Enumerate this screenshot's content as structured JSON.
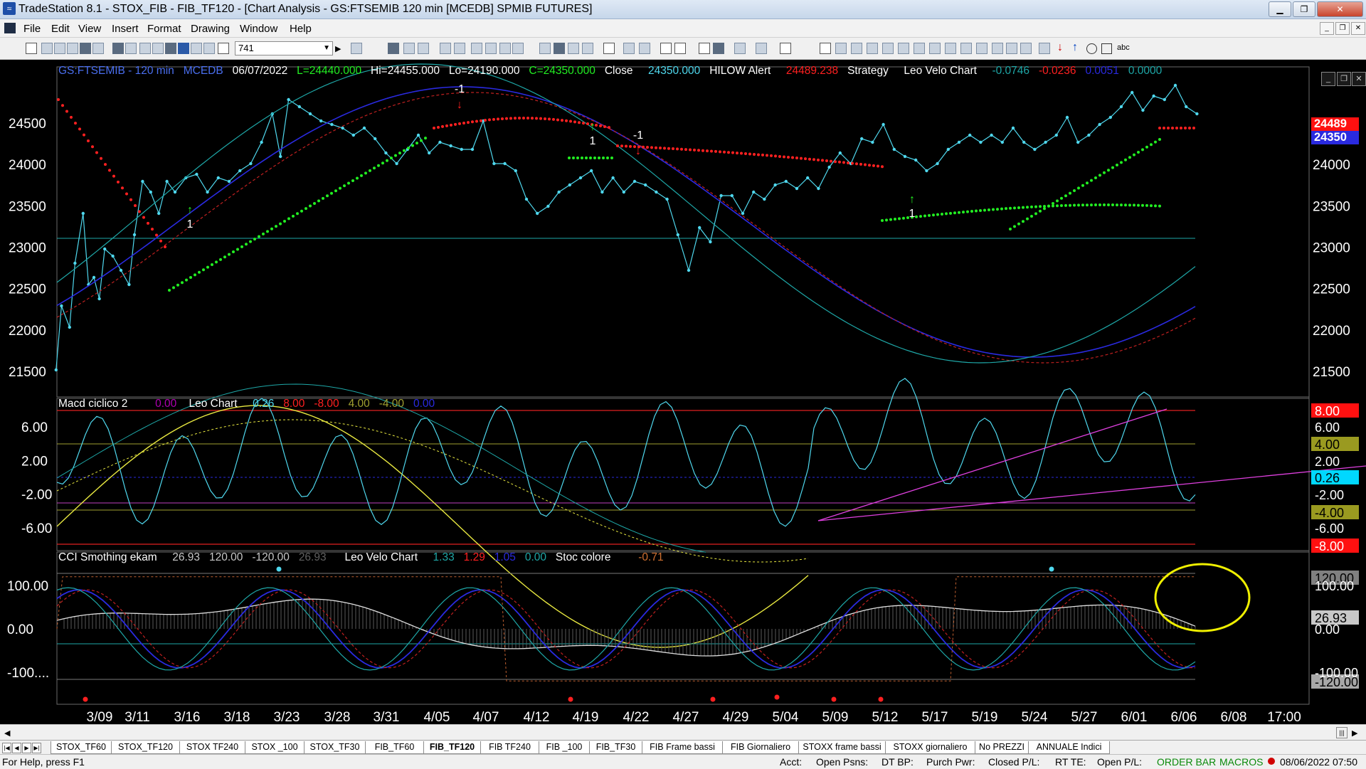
{
  "window": {
    "title": "TradeStation 8.1 - STOX_FIB - FIB_TF120 - [Chart Analysis - GS:FTSEMIB  120 min  [MCEDB] SPMIB FUTURES]",
    "icon": "tradestation-icon"
  },
  "menu": [
    "File",
    "Edit",
    "View",
    "Insert",
    "Format",
    "Drawing",
    "Window",
    "Help"
  ],
  "toolbar": {
    "combo_value": "741"
  },
  "price_panel": {
    "symbol": "GS:FTSEMIB - 120 min",
    "exchange": "MCEDB",
    "date": "06/07/2022",
    "L": "L=24440.000",
    "Hi": "Hi=24455.000",
    "Lo": "Lo=24190.000",
    "C": "C=24350.000",
    "close_label": "Close",
    "close_value": "24350.000",
    "hilow_label": "HILOW Alert",
    "hilow_value": "24489.238",
    "strategy_label": "Strategy",
    "velo_label": "Leo Velo Chart",
    "velo_v1": "-0.0746",
    "velo_v2": "-0.0236",
    "velo_v3": "0.0051",
    "velo_v4": "0.0000",
    "y_ticks": [
      "24500",
      "24000",
      "23500",
      "23000",
      "22500",
      "22000",
      "21500"
    ],
    "right_box_1": "24489",
    "right_box_2": "24350",
    "signals": [
      "1",
      "-1",
      "1",
      "-1",
      "1"
    ]
  },
  "macd_panel": {
    "label": "Macd ciclico 2",
    "v0": "0.00",
    "leo": "Leo Chart",
    "v1": "0.26",
    "v2": "8.00",
    "v3": "-8.00",
    "v4": "4.00",
    "v5": "-4.00",
    "v6": "0.00",
    "y_ticks": [
      "6.00",
      "2.00",
      "-2.00",
      "-6.00"
    ],
    "right_ticks": [
      "8.00",
      "6.00",
      "4.00",
      "2.00",
      "0.26",
      "-2.00",
      "-4.00",
      "-6.00",
      "-8.00"
    ]
  },
  "cci_panel": {
    "label": "CCI Smothing ekam",
    "v1": "26.93",
    "v2": "120.00",
    "v3": "-120.00",
    "v4": "26.93",
    "leo": "Leo Velo Chart",
    "v5": "1.33",
    "v6": "1.29",
    "v7": "1.05",
    "v8": "0.00",
    "stoc": "Stoc colore",
    "v9": "-0.71",
    "y_ticks": [
      "100.00",
      "0.00",
      "-100...."
    ],
    "right_ticks": [
      "120.00",
      "100.00",
      "26.93",
      "0.00",
      "-100.00",
      "-120.00"
    ]
  },
  "x_axis": [
    "3/09",
    "3/11",
    "3/16",
    "3/18",
    "3/23",
    "3/28",
    "3/31",
    "4/05",
    "4/07",
    "4/12",
    "4/19",
    "4/22",
    "4/27",
    "4/29",
    "5/04",
    "5/09",
    "5/12",
    "5/17",
    "5/19",
    "5/24",
    "5/27",
    "6/01",
    "6/06",
    "6/08",
    "17:00"
  ],
  "tabs": [
    "STOX_TF60",
    "STOX_TF120",
    "STOX TF240",
    "STOX _100",
    "STOX_TF30",
    "FIB_TF60",
    "FIB_TF120",
    "FIB TF240",
    "FIB _100",
    "FIB_TF30",
    "FIB Frame bassi",
    "FIB Giornaliero",
    "STOXX frame bassi",
    "STOXX giornaliero",
    "No PREZZI",
    "ANNUALE Indici"
  ],
  "active_tab": "FIB_TF120",
  "status": {
    "help": "For Help, press F1",
    "acct": "Acct:",
    "open_psns": "Open Psns:",
    "dt_bp": "DT BP:",
    "purch_pwr": "Purch Pwr:",
    "closed_pl": "Closed P/L:",
    "rt_te": "RT TE:",
    "open_pl": "Open P/L:",
    "order_bar": "ORDER BAR",
    "macros": "MACROS",
    "datetime": "08/06/2022 07:50"
  },
  "colors": {
    "cyan": "#4fd8ee",
    "red_dots": "#ff2020",
    "green_dots": "#22ee22",
    "blue_ma": "#2a2ae0",
    "teal": "#1ea7a7",
    "yellow": "#e8e840",
    "magenta": "#e040e0"
  }
}
